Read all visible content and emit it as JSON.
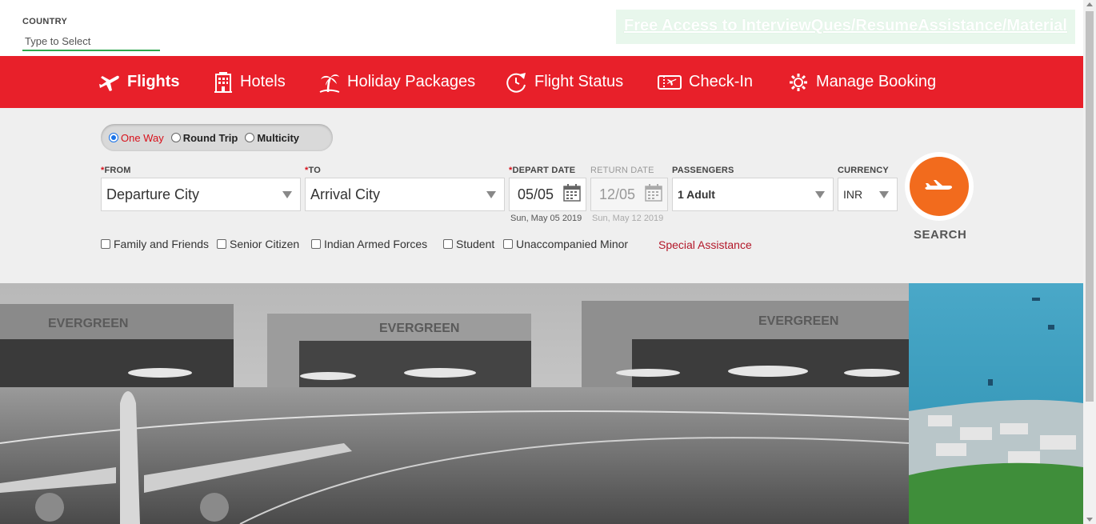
{
  "country": {
    "label": "COUNTRY",
    "placeholder": "Type to Select"
  },
  "promo": {
    "text": "Free Access to InterviewQues/ResumeAssistance/Material"
  },
  "nav": {
    "items": [
      {
        "label": "Flights",
        "icon": "plane-icon",
        "active": true
      },
      {
        "label": "Hotels",
        "icon": "hotel-building-icon"
      },
      {
        "label": "Holiday Packages",
        "icon": "palm-tree-icon"
      },
      {
        "label": "Flight Status",
        "icon": "clock-plane-icon"
      },
      {
        "label": "Check-In",
        "icon": "ticket-icon"
      },
      {
        "label": "Manage Booking",
        "icon": "gear-icon"
      }
    ]
  },
  "trip": {
    "options": [
      {
        "label": "One Way",
        "selected": true
      },
      {
        "label": "Round Trip",
        "selected": false
      },
      {
        "label": "Multicity",
        "selected": false
      }
    ]
  },
  "form": {
    "from_label": "FROM",
    "from_value": "Departure City",
    "to_label": "TO",
    "to_value": "Arrival City",
    "depart_label": "DEPART DATE",
    "depart_value": "05/05",
    "depart_sub": "Sun, May 05 2019",
    "return_label": "RETURN DATE",
    "return_value": "12/05",
    "return_sub": "Sun, May 12 2019",
    "passengers_label": "PASSENGERS",
    "passengers_value": "1 Adult",
    "currency_label": "CURRENCY",
    "currency_value": "INR",
    "required_mark": "*"
  },
  "discounts": {
    "items": [
      "Family and Friends",
      "Senior Citizen",
      "Indian Armed Forces",
      "Student",
      "Unaccompanied Minor"
    ],
    "special": "Special Assistance"
  },
  "search": {
    "label": "SEARCH"
  },
  "hero": {
    "hangar_text": [
      "EVERGREEN",
      "EVERGREEN",
      "EVERGREEN"
    ]
  },
  "colors": {
    "brand_red": "#e8202a",
    "search_orange": "#f26b1d",
    "accent_green": "#2fa84f"
  }
}
